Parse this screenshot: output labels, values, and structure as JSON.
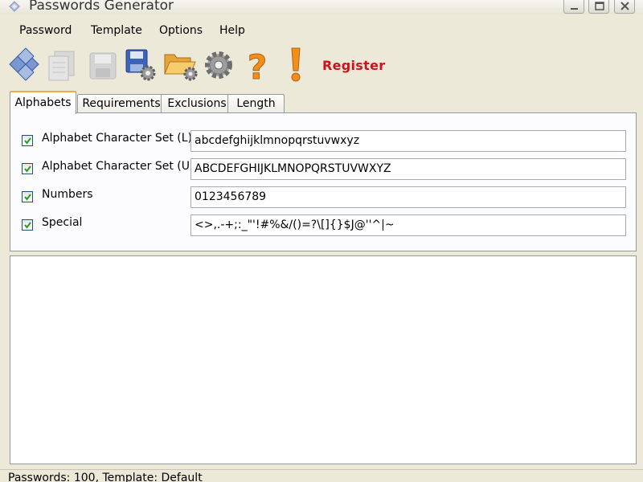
{
  "window": {
    "title": "Passwords Generator"
  },
  "menu": [
    "Password",
    "Template",
    "Options",
    "Help"
  ],
  "toolbar": {
    "icons": [
      "generate-icon",
      "copy-icon",
      "save-icon",
      "save-settings-icon",
      "open-folder-icon",
      "settings-gear-icon",
      "help-icon",
      "register-icon"
    ],
    "register_label": "Register"
  },
  "tabs": [
    "Alphabets",
    "Requirements",
    "Exclusions",
    "Length"
  ],
  "active_tab": "Alphabets",
  "alphabets": [
    {
      "label": "Alphabet Character Set (L)",
      "checked": true,
      "value": "abcdefghijklmnopqrstuvwxyz"
    },
    {
      "label": "Alphabet Character Set (U)",
      "checked": true,
      "value": "ABCDEFGHIJKLMNOPQRSTUVWXYZ"
    },
    {
      "label": "Numbers",
      "checked": true,
      "value": "0123456789"
    },
    {
      "label": "Special",
      "checked": true,
      "value": "<>,.-+;:_\"'!#%&/()=?\\[]{}$J@''^|~"
    }
  ],
  "output": {
    "text": ""
  },
  "status": "Passwords: 100, Template: Default",
  "colors": {
    "register": "#c8141e",
    "active_tab_accent": "#f0a848",
    "window_bg": "#ece9d8"
  }
}
